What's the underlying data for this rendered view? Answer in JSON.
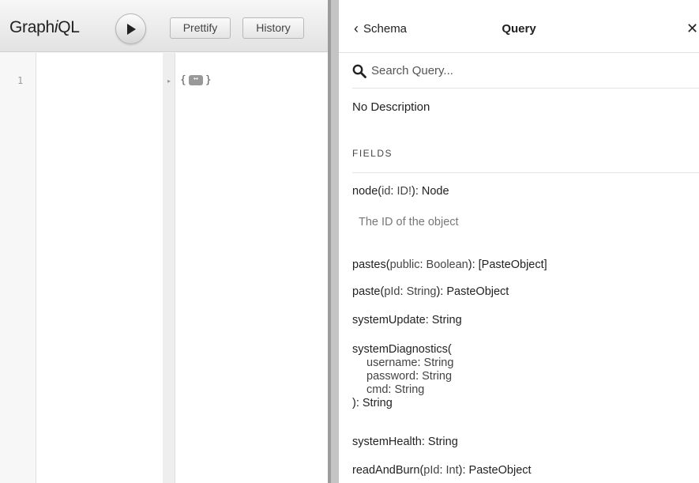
{
  "toolbar": {
    "logo_prefix": "Graph",
    "logo_i": "i",
    "logo_suffix": "QL",
    "prettify_label": "Prettify",
    "history_label": "History"
  },
  "editor": {
    "line_number": "1"
  },
  "result": {
    "open_brace": "{",
    "ellipsis": "↔",
    "close_brace": "}"
  },
  "docs": {
    "back_label": "Schema",
    "title": "Query",
    "close_label": "✕",
    "search_placeholder": "Search Query...",
    "description": "No Description",
    "fields_header": "FIELDS",
    "fields": [
      {
        "name": "node",
        "open": "(",
        "arg": "id",
        "colon": ": ",
        "argtype": "ID!",
        "close": "): ",
        "type": "Node"
      },
      {
        "name": "pastes",
        "open": "(",
        "arg": "public",
        "colon": ": ",
        "argtype": "Boolean",
        "close": "): ",
        "type": "[PasteObject]"
      },
      {
        "name": "paste",
        "open": "(",
        "arg": "pId",
        "colon": ": ",
        "argtype": "String",
        "close": "): ",
        "type": "PasteObject"
      },
      {
        "name": "systemUpdate",
        "sep": ": ",
        "type": "String"
      },
      {
        "name": "systemDiagnostics",
        "open": "(",
        "args": [
          {
            "arg": "username",
            "colon": ": ",
            "argtype": "String"
          },
          {
            "arg": "password",
            "colon": ": ",
            "argtype": "String"
          },
          {
            "arg": "cmd",
            "colon": ": ",
            "argtype": "String"
          }
        ],
        "close": "): ",
        "type": "String"
      },
      {
        "name": "systemHealth",
        "sep": ": ",
        "type": "String"
      },
      {
        "name": "readAndBurn",
        "open": "(",
        "arg": "pId",
        "colon": ": ",
        "argtype": "Int",
        "close": "): ",
        "type": "PasteObject"
      }
    ],
    "node_description": "The ID of the object"
  }
}
